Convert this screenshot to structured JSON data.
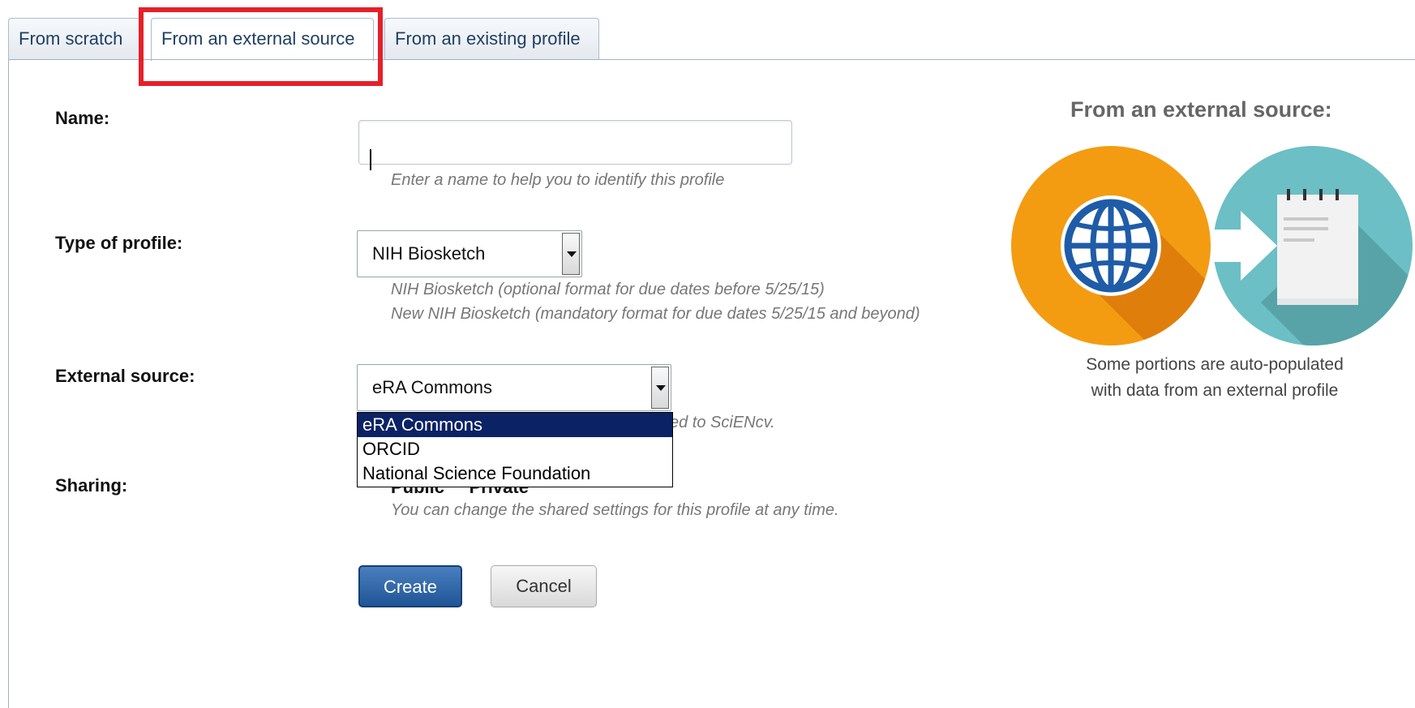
{
  "tabs": [
    {
      "label": "From scratch"
    },
    {
      "label": "From an external source"
    },
    {
      "label": "From an existing profile"
    }
  ],
  "form": {
    "name": {
      "label": "Name:",
      "value": "",
      "hint": "Enter a name to help you to identify this profile"
    },
    "type": {
      "label": "Type of profile:",
      "selected": "NIH Biosketch",
      "hint_lines": [
        "NIH Biosketch (optional format for due dates before 5/25/15)",
        "New NIH Biosketch (mandatory format for due dates 5/25/15 and beyond)"
      ]
    },
    "external": {
      "label": "External source:",
      "selected": "eRA Commons",
      "options": [
        "eRA Commons",
        "ORCID",
        "National Science Foundation"
      ],
      "partial_hint": "ed to SciENcv."
    },
    "sharing": {
      "label": "Sharing:",
      "partial_options": "Public     Private",
      "hint": "You can change the shared settings for this profile at any time."
    },
    "buttons": {
      "create": "Create",
      "cancel": "Cancel"
    }
  },
  "side": {
    "title": "From an external source:",
    "caption_lines": [
      "Some portions are auto-populated",
      "with data from an external profile"
    ],
    "colors": {
      "orange": "#f39c12",
      "teal": "#6bbfc5",
      "globe": "#1f5ca8"
    }
  }
}
